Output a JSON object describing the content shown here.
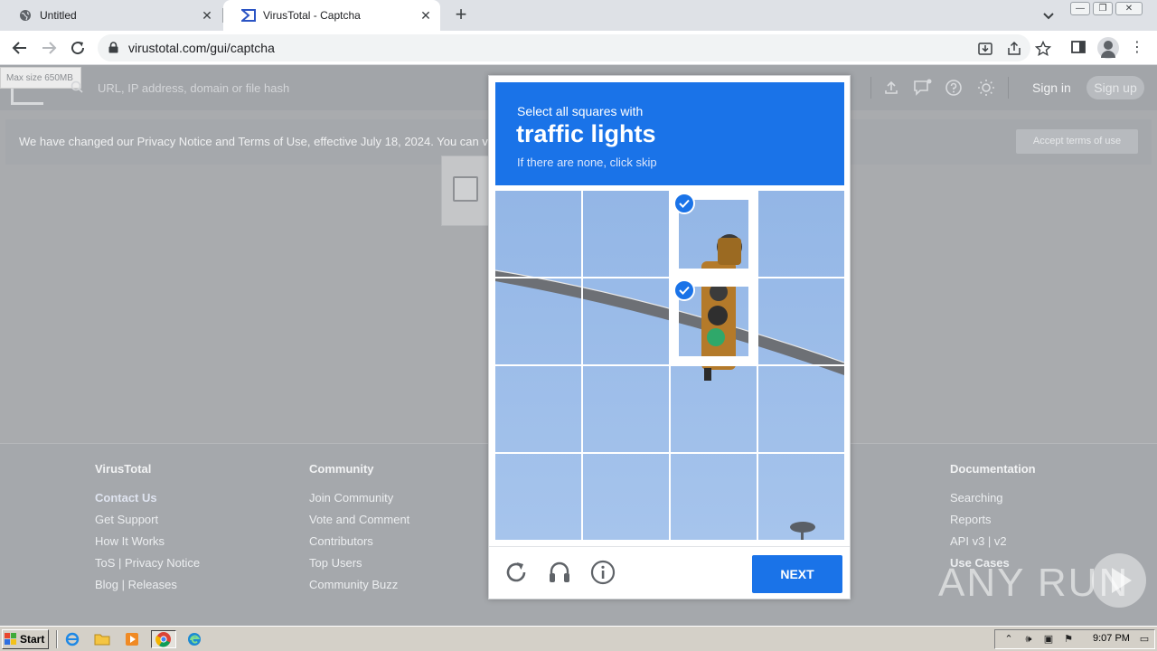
{
  "browser": {
    "tabs": [
      {
        "title": "Untitled",
        "active": false,
        "icon": "globe-icon"
      },
      {
        "title": "VirusTotal - Captcha",
        "active": true,
        "icon": "virustotal-icon"
      }
    ],
    "url": "virustotal.com/gui/captcha"
  },
  "vt": {
    "max_size": "Max size 650MB",
    "search_placeholder": "URL, IP address, domain or file hash",
    "sign_in": "Sign in",
    "sign_up": "Sign up",
    "notice": "We have changed our Privacy Notice and Terms of Use, effective July 18, 2024. You can v",
    "accept": "Accept terms of use"
  },
  "footer": {
    "columns": [
      {
        "heading": "VirusTotal",
        "links": [
          "Contact Us",
          "Get Support",
          "How It Works",
          "ToS | Privacy Notice",
          "Blog | Releases"
        ]
      },
      {
        "heading": "Community",
        "links": [
          "Join Community",
          "Vote and Comment",
          "Contributors",
          "Top Users",
          "Community Buzz"
        ]
      },
      {
        "heading": "Documentation",
        "links": [
          "Searching",
          "Reports",
          "API v3 | v2",
          "Use Cases"
        ]
      }
    ]
  },
  "watermark": "ANY RUN",
  "captcha": {
    "instruction": "Select all squares with",
    "target": "traffic lights",
    "hint": "If there are none, click skip",
    "next": "NEXT",
    "grid_size": 4,
    "selected_tiles": [
      [
        0,
        2
      ],
      [
        1,
        2
      ]
    ]
  },
  "taskbar": {
    "start": "Start",
    "clock": "9:07 PM"
  },
  "colors": {
    "captcha_blue": "#1a73e8",
    "chrome_tabstrip": "#dee1e6",
    "overlay_gray": "#a9abae",
    "taskbar": "#d4d0c8"
  }
}
